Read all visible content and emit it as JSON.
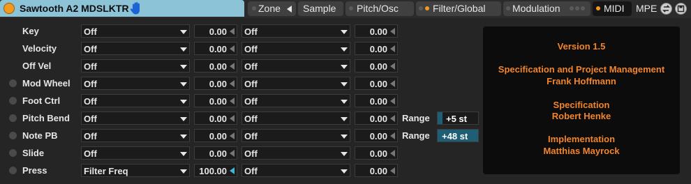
{
  "header": {
    "title": "Sawtooth A2 MDSLKTR",
    "tabs": [
      {
        "label": "Zone"
      },
      {
        "label": "Sample"
      },
      {
        "label": "Pitch/Osc"
      },
      {
        "label": "Filter/Global"
      },
      {
        "label": "Modulation"
      },
      {
        "label": "MIDI"
      },
      {
        "label": "MPE"
      }
    ]
  },
  "rows": [
    {
      "label": "Key",
      "src": "Off",
      "amt1": "0.00",
      "dst": "Off",
      "amt2": "0.00"
    },
    {
      "label": "Velocity",
      "src": "Off",
      "amt1": "0.00",
      "dst": "Off",
      "amt2": "0.00"
    },
    {
      "label": "Off Vel",
      "src": "Off",
      "amt1": "0.00",
      "dst": "Off",
      "amt2": "0.00"
    },
    {
      "label": "Mod Wheel",
      "src": "Off",
      "amt1": "0.00",
      "dst": "Off",
      "amt2": "0.00"
    },
    {
      "label": "Foot Ctrl",
      "src": "Off",
      "amt1": "0.00",
      "dst": "Off",
      "amt2": "0.00"
    },
    {
      "label": "Pitch Bend",
      "src": "Off",
      "amt1": "0.00",
      "dst": "Off",
      "amt2": "0.00",
      "range_label": "Range",
      "range_value": "+5 st",
      "range_fill": 0.12
    },
    {
      "label": "Note PB",
      "src": "Off",
      "amt1": "0.00",
      "dst": "Off",
      "amt2": "0.00",
      "range_label": "Range",
      "range_value": "+48 st",
      "range_fill": 1.0
    },
    {
      "label": "Slide",
      "src": "Off",
      "amt1": "0.00",
      "dst": "Off",
      "amt2": "0.00"
    },
    {
      "label": "Press",
      "src": "Filter Freq",
      "amt1": "100.00",
      "dst": "Off",
      "amt2": "0.00"
    }
  ],
  "credits": {
    "version": "Version 1.5",
    "spec_pm_title": "Specification and Project Management",
    "spec_pm_name": "Frank Hoffmann",
    "spec_title": "Specification",
    "spec_name": "Robert Henke",
    "impl_title": "Implementation",
    "impl_name": "Matthias Mayrock"
  },
  "icons": [
    "power-icon",
    "hand-icon",
    "swap-icon",
    "save-icon"
  ],
  "colors": {
    "title_bg": "#8cc3d6",
    "accent_orange": "#f39a1e",
    "credit_text": "#f2852c",
    "range_fill": "#1f5f75"
  }
}
